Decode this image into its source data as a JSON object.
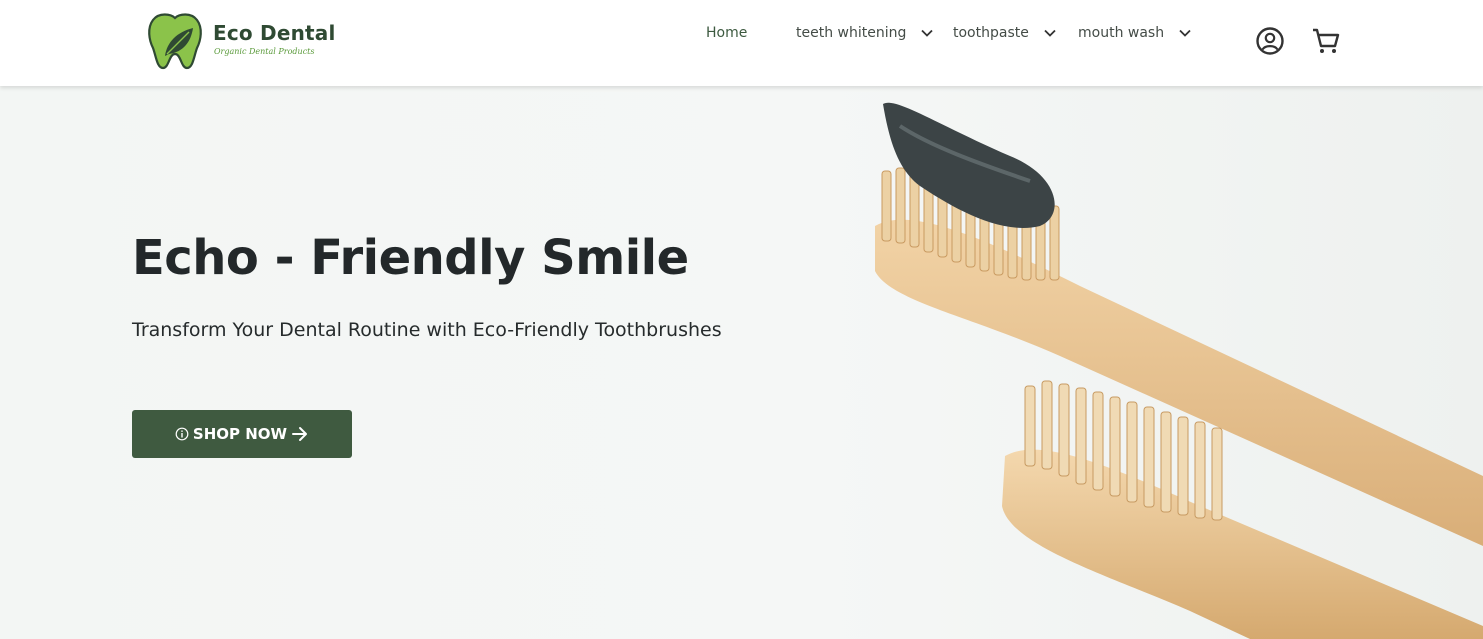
{
  "brand": {
    "name": "Eco Dental",
    "tagline": "Organic Dental Products",
    "colors": {
      "primary": "#3f5a40",
      "accent": "#8bc34a",
      "dark": "#2f4a33"
    }
  },
  "nav": {
    "items": [
      {
        "label": "Home",
        "has_dropdown": false
      },
      {
        "label": "teeth whitening",
        "has_dropdown": true
      },
      {
        "label": "toothpaste",
        "has_dropdown": true
      },
      {
        "label": "mouth wash",
        "has_dropdown": true
      }
    ],
    "icons": [
      "account-icon",
      "cart-icon"
    ]
  },
  "hero": {
    "title": "Echo - Friendly Smile",
    "subtitle": "Transform Your Dental Routine with Eco-Friendly Toothbrushes",
    "cta_label": "SHOP NOW",
    "cta_icons": [
      "info-icon",
      "arrow-right-icon"
    ],
    "image": "bamboo-toothbrushes-with-charcoal-toothpaste"
  }
}
